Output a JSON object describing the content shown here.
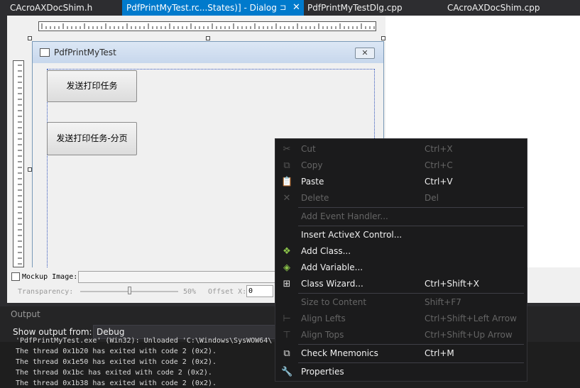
{
  "tabs": [
    {
      "label": "CAcroAXDocShim.h",
      "active": false
    },
    {
      "label": "PdfPrintMyTest.rc...States)] - Dialog",
      "active": true,
      "pin": "⊐",
      "close": "✕"
    },
    {
      "label": "PdfPrintMyTestDlg.cpp",
      "active": false
    },
    {
      "label": "CAcroAXDocShim.cpp",
      "active": false
    }
  ],
  "dialog": {
    "title": "PdfPrintMyTest",
    "close_glyph": "✕",
    "buttons": [
      "发送打印任务",
      "发送打印任务-分页"
    ]
  },
  "mockup": {
    "label": "Mockup Image:",
    "transparency_label": "Transparency:",
    "transparency_value": "50%",
    "transparency_fraction": 0.5,
    "offset_label": "Offset X:",
    "offset_x_value": "0"
  },
  "output": {
    "title": "Output",
    "show_from_label": "Show output from:",
    "source": "Debug",
    "lines": [
      "'PdfPrintMyTest.exe' (Win32): Unloaded 'C:\\Windows\\SysWOW64\\",
      "The thread 0x1b20 has exited with code 2 (0x2).",
      "The thread 0x1e50 has exited with code 2 (0x2).",
      "The thread 0x1bc has exited with code 2 (0x2).",
      "The thread 0x1b38 has exited with code 2 (0x2)."
    ]
  },
  "context_menu": {
    "items": [
      {
        "label": "Cut",
        "shortcut": "Ctrl+X",
        "enabled": false,
        "icon": "cut-icon"
      },
      {
        "label": "Copy",
        "shortcut": "Ctrl+C",
        "enabled": false,
        "icon": "copy-icon"
      },
      {
        "label": "Paste",
        "shortcut": "Ctrl+V",
        "enabled": true,
        "icon": "paste-icon"
      },
      {
        "label": "Delete",
        "shortcut": "Del",
        "enabled": false,
        "icon": "delete-icon"
      },
      {
        "label": "Add Event Handler...",
        "shortcut": "",
        "enabled": false,
        "icon": ""
      },
      {
        "label": "Insert ActiveX Control...",
        "shortcut": "",
        "enabled": true,
        "icon": ""
      },
      {
        "label": "Add Class...",
        "shortcut": "",
        "enabled": true,
        "icon": "add-class-icon"
      },
      {
        "label": "Add Variable...",
        "shortcut": "",
        "enabled": true,
        "icon": "add-variable-icon"
      },
      {
        "label": "Class Wizard...",
        "shortcut": "Ctrl+Shift+X",
        "enabled": true,
        "icon": "class-wizard-icon"
      },
      {
        "label": "Size to Content",
        "shortcut": "Shift+F7",
        "enabled": false,
        "icon": ""
      },
      {
        "label": "Align Lefts",
        "shortcut": "Ctrl+Shift+Left Arrow",
        "enabled": false,
        "icon": "align-lefts-icon"
      },
      {
        "label": "Align Tops",
        "shortcut": "Ctrl+Shift+Up Arrow",
        "enabled": false,
        "icon": "align-tops-icon"
      },
      {
        "label": "Check Mnemonics",
        "shortcut": "Ctrl+M",
        "enabled": true,
        "icon": "check-mnemonics-icon"
      },
      {
        "label": "Properties",
        "shortcut": "",
        "enabled": true,
        "icon": "wrench-icon"
      }
    ]
  }
}
